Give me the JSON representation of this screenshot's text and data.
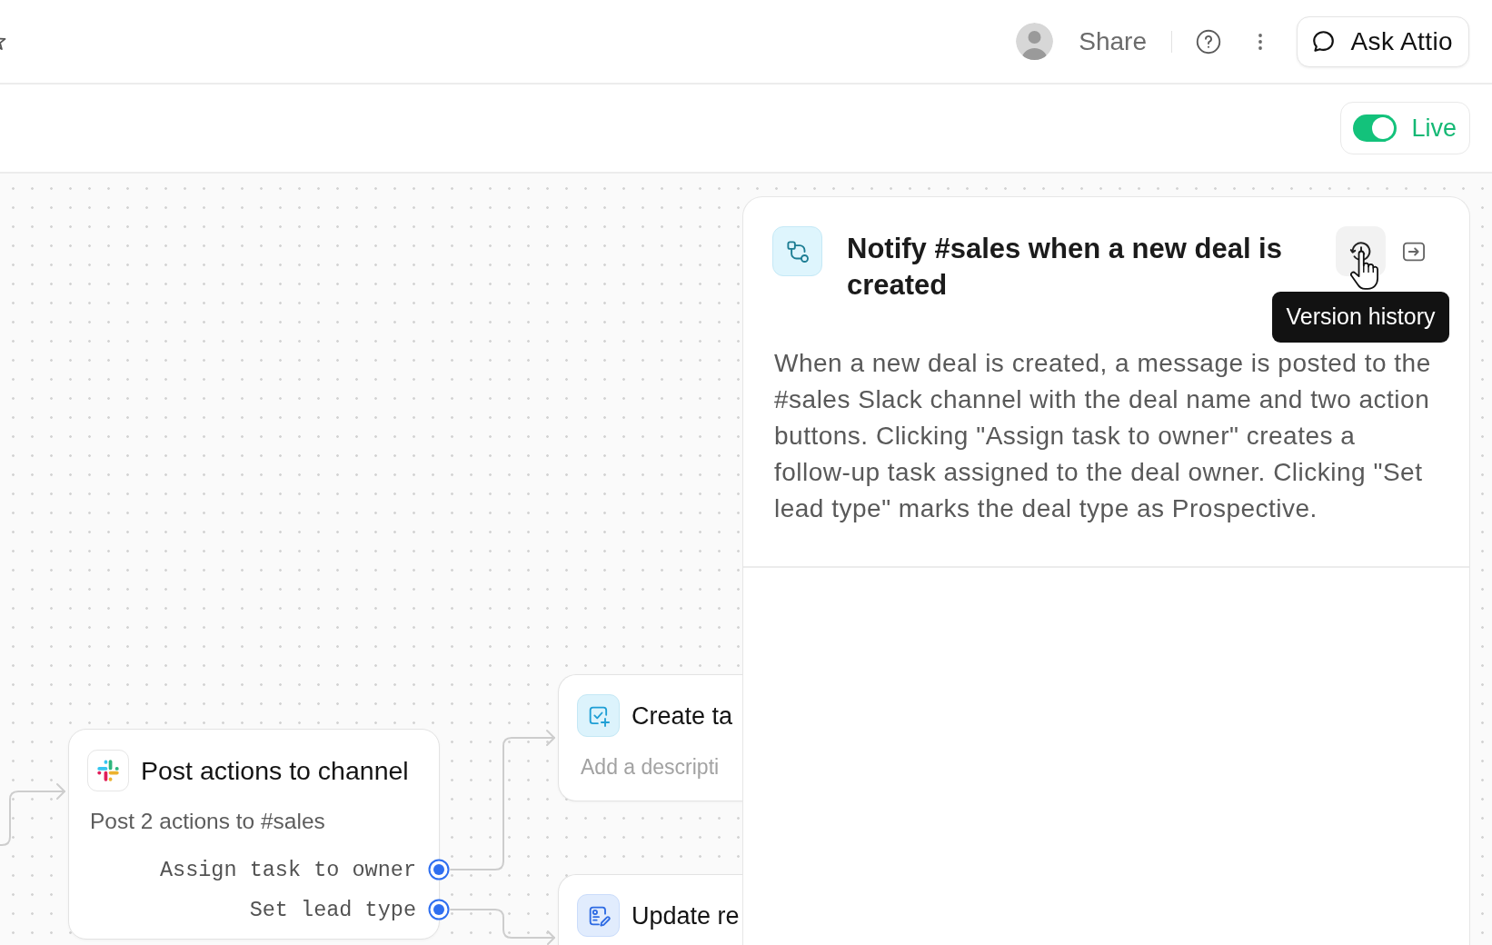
{
  "top_bar": {
    "share_button": "Share",
    "ask_button": "Ask Attio"
  },
  "toolbar": {
    "live_toggle": {
      "label": "Live",
      "on": true
    }
  },
  "side_panel": {
    "title": "Notify #sales when a new deal is created",
    "tooltip": "Version history",
    "description": "When a new deal is created, a message is posted to the #sales Slack channel with the deal name and two action buttons. Clicking \"Assign task to owner\" creates a follow-up task assigned to the deal owner. Clicking \"Set lead type\" marks the deal type as Prospective."
  },
  "canvas": {
    "nodes": [
      {
        "kind": "slack",
        "title": "Post actions to channel",
        "description": "Post 2 actions to #sales",
        "outputs": [
          "Assign task to owner",
          "Set lead type"
        ]
      },
      {
        "kind": "task",
        "title": "Create ta",
        "placeholder": "Add a descripti"
      },
      {
        "kind": "record",
        "title": "Update re"
      }
    ]
  }
}
